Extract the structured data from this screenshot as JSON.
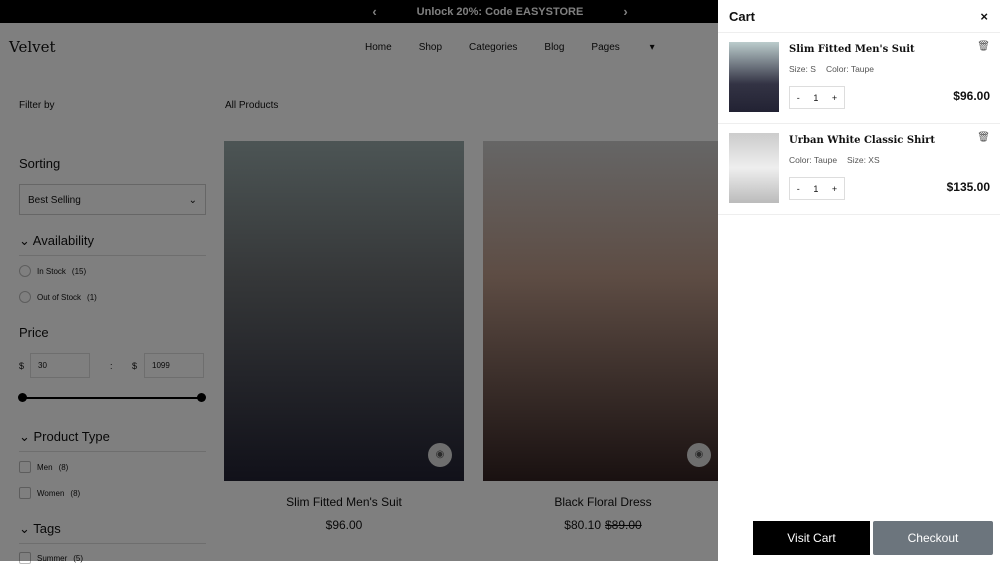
{
  "promo": {
    "text": "Unlock 20%: Code EASYSTORE",
    "prev": "‹",
    "next": "›"
  },
  "header": {
    "logo": "Velvet",
    "nav": [
      "Home",
      "Shop",
      "Categories",
      "Blog",
      "Pages"
    ]
  },
  "filter": {
    "title": "Filter by",
    "sorting": "Sorting",
    "sort_value": "Best Selling",
    "availability": "Availability",
    "in_stock": "In Stock",
    "in_stock_count": "(15)",
    "out_stock": "Out of Stock",
    "out_stock_count": "(1)",
    "price": "Price",
    "currency": "$",
    "min": "30",
    "max": "1099",
    "sep": ":",
    "product_type": "Product Type",
    "men": "Men",
    "men_count": "(8)",
    "women": "Women",
    "women_count": "(8)",
    "tags": "Tags",
    "summer": "Summer",
    "summer_count": "(5)"
  },
  "main": {
    "heading": "All Products",
    "products": [
      {
        "title": "Slim Fitted Men's Suit",
        "price": "$96.00"
      },
      {
        "title": "Black Floral Dress",
        "price": "$80.10",
        "old_price": "$89.00"
      }
    ]
  },
  "cart": {
    "title": "Cart",
    "close": "×",
    "items": [
      {
        "name": "Slim Fitted Men's Suit",
        "meta1": "Size: S",
        "meta2": "Color: Taupe",
        "qty": "1",
        "price": "$96.00"
      },
      {
        "name": "Urban White Classic Shirt",
        "meta1": "Color: Taupe",
        "meta2": "Size: XS",
        "qty": "1",
        "price": "$135.00"
      }
    ],
    "visit": "Visit Cart",
    "checkout": "Checkout",
    "minus": "-",
    "plus": "+"
  }
}
